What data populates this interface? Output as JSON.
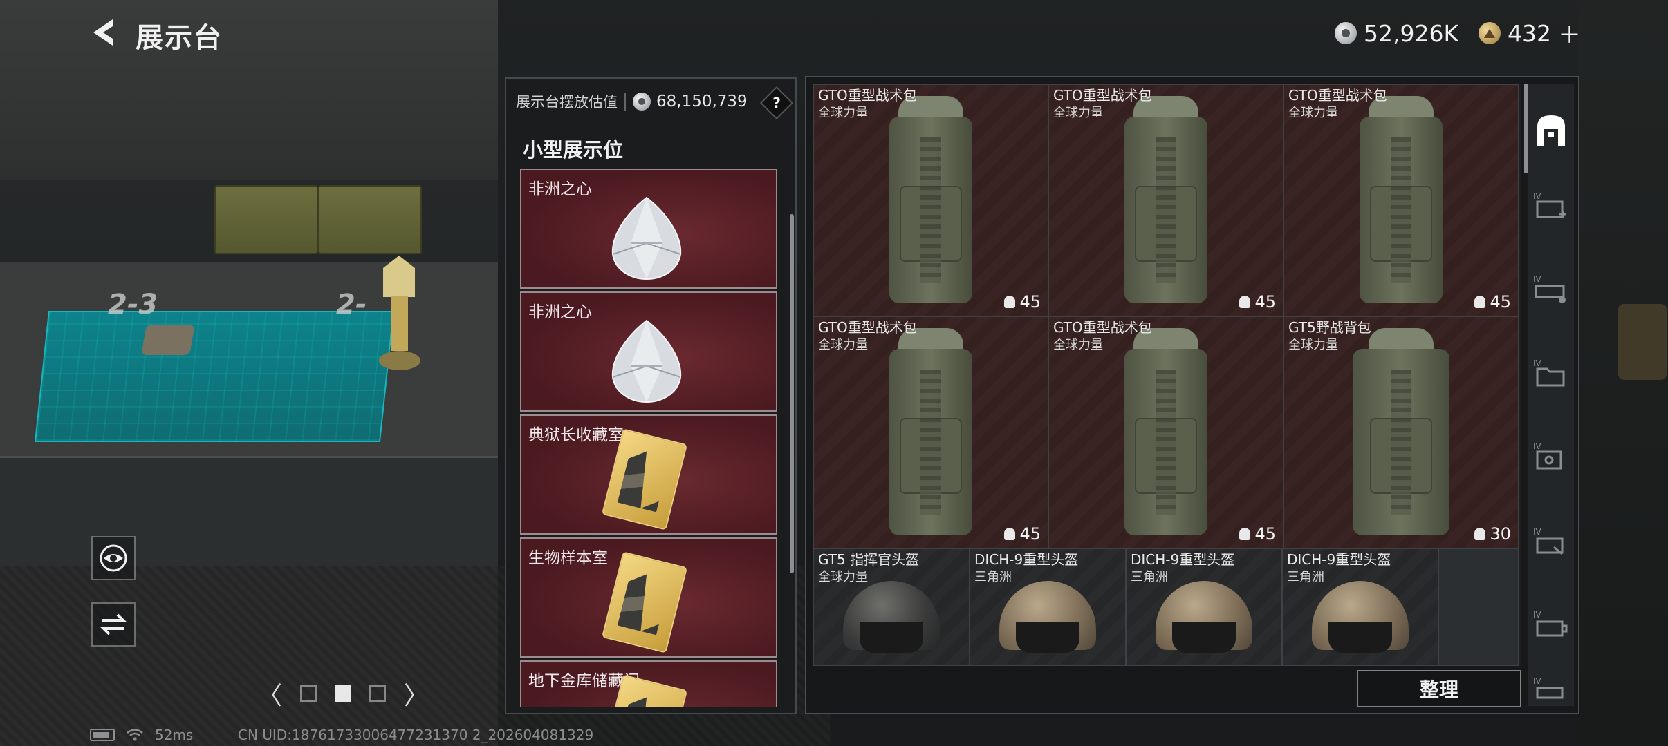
{
  "header": {
    "title": "展示台"
  },
  "currency": {
    "silver": "52,926K",
    "gold": "432",
    "gold_add": "＋"
  },
  "scene": {
    "slot_a": "2-3",
    "slot_b": "2-"
  },
  "pager": {
    "prev": "〈",
    "next": "〉"
  },
  "status": {
    "ping": "52ms",
    "uid": "CN UID:18761733006477231370 2_202604081329"
  },
  "display": {
    "estimate_label": "展示台摆放估值",
    "estimate_value": "68,150,739",
    "help": "?",
    "section_title": "小型展示位",
    "items": [
      {
        "name": "非洲之心",
        "icon": "diamond"
      },
      {
        "name": "非洲之心",
        "icon": "diamond"
      },
      {
        "name": "典狱长收藏室",
        "icon": "keycard"
      },
      {
        "name": "生物样本室",
        "icon": "keycard"
      },
      {
        "name": "地下金库储藏间",
        "icon": "keycard"
      }
    ]
  },
  "inventory": {
    "items": [
      {
        "name": "GTO重型战术包",
        "sub": "全球力量",
        "count": "45",
        "icon": "backpack"
      },
      {
        "name": "GTO重型战术包",
        "sub": "全球力量",
        "count": "45",
        "icon": "backpack"
      },
      {
        "name": "GTO重型战术包",
        "sub": "全球力量",
        "count": "45",
        "icon": "backpack"
      },
      {
        "name": "GTO重型战术包",
        "sub": "全球力量",
        "count": "45",
        "icon": "backpack"
      },
      {
        "name": "GTO重型战术包",
        "sub": "全球力量",
        "count": "45",
        "icon": "backpack"
      },
      {
        "name": "GT5野战背包",
        "sub": "全球力量",
        "count": "30",
        "icon": "backpack"
      },
      {
        "name": "GT5 指挥官头盔",
        "sub": "全球力量",
        "icon": "helmet"
      },
      {
        "name": "DICH-9重型头盔",
        "sub": "三角洲",
        "icon": "helmet"
      },
      {
        "name": "DICH-9重型头盔",
        "sub": "三角洲",
        "icon": "helmet"
      },
      {
        "name": "DICH-9重型头盔",
        "sub": "三角洲",
        "icon": "helmet"
      }
    ],
    "sort_label": "整理",
    "tabs": [
      "IV",
      "IV",
      "IV",
      "IV",
      "IV",
      "IV",
      "IV"
    ]
  },
  "colors": {
    "accent_teal": "#0a8b94",
    "card_red": "#4b1a20"
  }
}
